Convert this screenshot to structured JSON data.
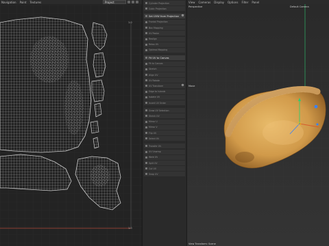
{
  "uv_editor": {
    "menu": [
      "Navigation",
      "Paint",
      "Textures"
    ],
    "project_select": "Project",
    "corner_top": "1.0",
    "corner_bottom": "1.0"
  },
  "palette": {
    "items": [
      {
        "label": "Cylinder Projection",
        "highlight": false
      },
      {
        "label": "Cubic Projection",
        "highlight": false
      },
      {
        "label": "Set UVW from Projection",
        "highlight": true,
        "gear": true
      },
      {
        "label": "Frontal Projection",
        "highlight": false
      },
      {
        "label": "Box Mapping",
        "highlight": false
      },
      {
        "label": "UV Peeler",
        "highlight": false
      },
      {
        "label": "Realign",
        "highlight": false
      },
      {
        "label": "Relax UV",
        "highlight": false
      },
      {
        "label": "Optimal Mapping",
        "highlight": false
      },
      {
        "label": "Fit UV to Canvas",
        "highlight": true
      },
      {
        "label": "Fit to Canvas",
        "highlight": false
      },
      {
        "label": "Stretch",
        "highlight": false
      },
      {
        "label": "Align UV",
        "highlight": false
      },
      {
        "label": "UV Rotate",
        "highlight": false
      },
      {
        "label": "UV Transform",
        "highlight": false,
        "gear": true
      },
      {
        "label": "Edge to Islands",
        "highlight": false
      },
      {
        "label": "Isolate UV",
        "highlight": false
      },
      {
        "label": "Invert UV Order",
        "highlight": false
      },
      {
        "label": "Grow UV Selection",
        "highlight": false
      },
      {
        "label": "Shrink UV",
        "highlight": false
      },
      {
        "label": "Mirror U",
        "highlight": false
      },
      {
        "label": "Mirror V",
        "highlight": false
      },
      {
        "label": "Flip UV",
        "highlight": false
      },
      {
        "label": "Select UV",
        "highlight": false
      },
      {
        "label": "Transfer UV",
        "highlight": false
      },
      {
        "label": "UV Unwrap",
        "highlight": false
      },
      {
        "label": "Weld UV",
        "highlight": false
      },
      {
        "label": "Split UV",
        "highlight": false
      },
      {
        "label": "Cut UV",
        "highlight": false
      },
      {
        "label": "Snap UV",
        "highlight": false
      }
    ]
  },
  "viewport": {
    "menu": [
      "View",
      "Cameras",
      "Display",
      "Options",
      "Filter",
      "Panel"
    ],
    "camera_type": "Perspective",
    "camera_name": "Default Camera",
    "axis_label": "Move",
    "status": "View Transform: Scene"
  },
  "colors": {
    "uv_grid": "#3a3a3a",
    "mesh": "#c9c9c9",
    "dough": "#d9a453",
    "axis_y": "#2ecc71",
    "axis_x": "#d65b2d",
    "axis_z": "#3b82f6",
    "canvas_border": "#c0392b"
  }
}
